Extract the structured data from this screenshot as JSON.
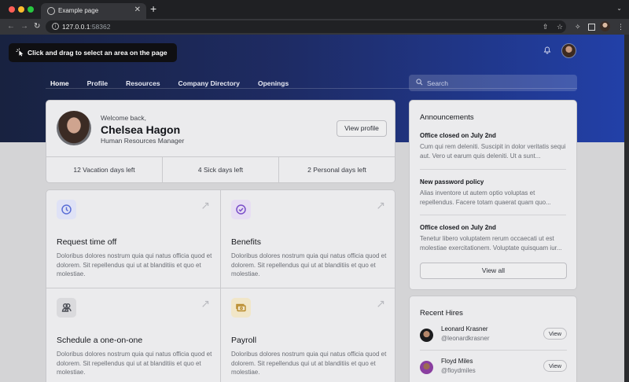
{
  "browser": {
    "tab_title": "Example page",
    "tab_close": "✕",
    "new_tab": "+",
    "tab_dropdown": "⌄",
    "url_host": "127.0.0.1",
    "url_port": ":58362"
  },
  "overlay": {
    "text": "Click and drag to select an area on the page"
  },
  "nav": {
    "items": [
      "Home",
      "Profile",
      "Resources",
      "Company Directory",
      "Openings"
    ],
    "active": "Home"
  },
  "search": {
    "placeholder": "Search"
  },
  "profile": {
    "welcome": "Welcome back,",
    "name": "Chelsea Hagon",
    "role": "Human Resources Manager",
    "view_profile": "View profile",
    "stats": [
      "12 Vacation days left",
      "4 Sick days left",
      "2 Personal days left"
    ]
  },
  "actions": [
    {
      "title": "Request time off",
      "description": "Doloribus dolores nostrum quia qui natus officia quod et dolorem. Sit repellendus qui ut at blanditiis et quo et molestiae.",
      "icon": "clock-icon",
      "color": "#5b6fd6"
    },
    {
      "title": "Benefits",
      "description": "Doloribus dolores nostrum quia qui natus officia quod et dolorem. Sit repellendus qui ut at blanditiis et quo et molestiae.",
      "icon": "check-badge-icon",
      "color": "#7b4fc9"
    },
    {
      "title": "Schedule a one-on-one",
      "description": "Doloribus dolores nostrum quia qui natus officia quod et dolorem. Sit repellendus qui ut at blanditiis et quo et molestiae.",
      "icon": "users-icon",
      "color": "#4a4d55"
    },
    {
      "title": "Payroll",
      "description": "Doloribus dolores nostrum quia qui natus officia quod et dolorem. Sit repellendus qui ut at blanditiis et quo et molestiae.",
      "icon": "cash-icon",
      "color": "#b8892a"
    }
  ],
  "announcements": {
    "heading": "Announcements",
    "items": [
      {
        "title": "Office closed on July 2nd",
        "body": "Cum qui rem deleniti. Suscipit in dolor veritatis sequi aut. Vero ut earum quis deleniti. Ut a sunt..."
      },
      {
        "title": "New password policy",
        "body": "Alias inventore ut autem optio voluptas et repellendus. Facere totam quaerat quam quo..."
      },
      {
        "title": "Office closed on July 2nd",
        "body": "Tenetur libero voluptatem rerum occaecati ut est molestiae exercitationem. Voluptate quisquam iur..."
      }
    ],
    "view_all": "View all"
  },
  "recent_hires": {
    "heading": "Recent Hires",
    "items": [
      {
        "name": "Leonard Krasner",
        "handle": "@leonardkrasner",
        "action": "View"
      },
      {
        "name": "Floyd Miles",
        "handle": "@floydmiles",
        "action": "View"
      }
    ]
  },
  "colors": {
    "hero_gradient_start": "#182240",
    "hero_gradient_end": "#2240a8"
  }
}
